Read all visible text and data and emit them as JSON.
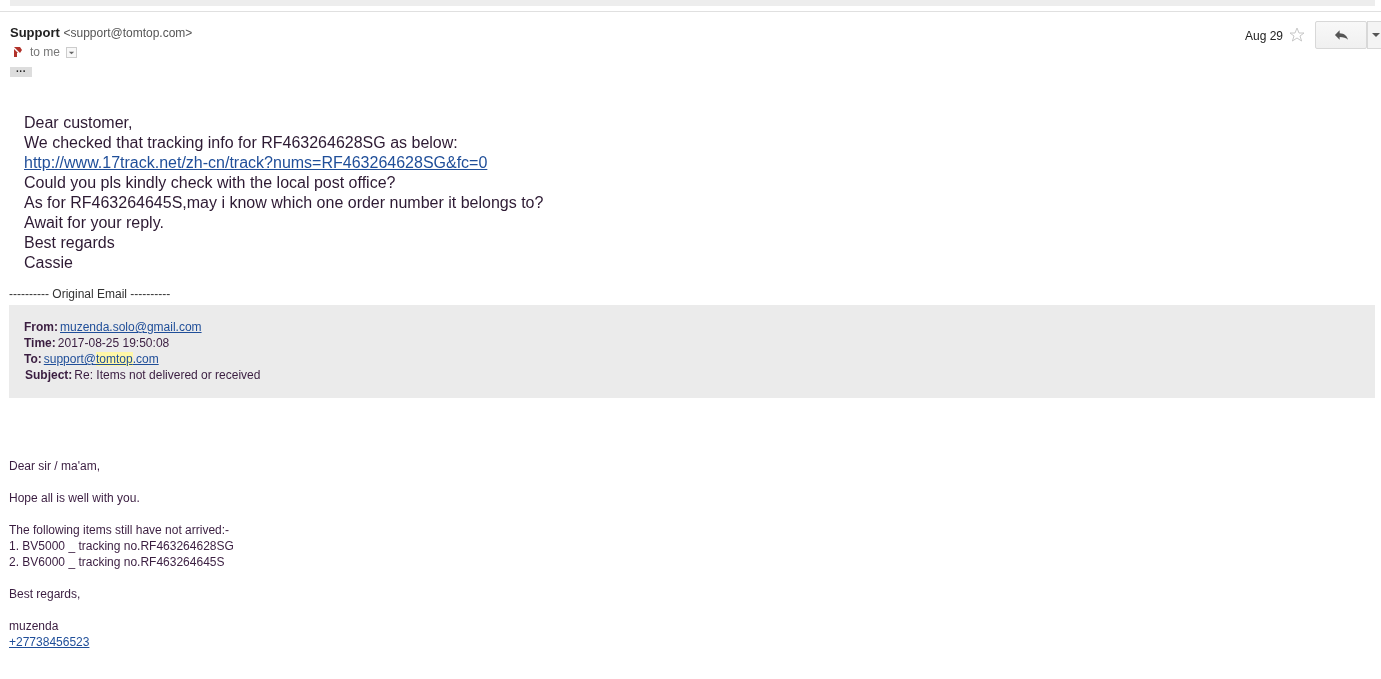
{
  "header": {
    "sender_name": "Support",
    "sender_email": "<support@tomtop.com>",
    "recipient": "to me",
    "date": "Aug 29",
    "starred": false,
    "more_label": "···"
  },
  "reply": [
    {
      "kind": "text",
      "text": "Dear customer,"
    },
    {
      "kind": "text",
      "text": "We checked that tracking info for RF463264628SG as below:"
    },
    {
      "kind": "link",
      "text": "http://www.17track.net/zh-cn/track?nums=RF463264628SG&fc=0"
    },
    {
      "kind": "text",
      "text": "Could you pls kindly check with the local post office?"
    },
    {
      "kind": "text",
      "text": "As for RF463264645S,may i know which one order number it belongs to?"
    },
    {
      "kind": "text",
      "text": "Await for your reply."
    },
    {
      "kind": "text",
      "text": "Best regards"
    },
    {
      "kind": "text",
      "text": "Cassie"
    }
  ],
  "divider": "---------- Original Email ----------",
  "original": {
    "from_label": "From:",
    "from": "muzenda.solo@gmail.com",
    "time_label": "Time:",
    "time": "2017-08-25 19:50:08",
    "to_label": "To:",
    "to": {
      "before": "support@",
      "highlight": "tomtop",
      "after": ".com"
    },
    "subject_label": "Subject:",
    "subject": "Re: Items not delivered or received"
  },
  "message": [
    {
      "lines": [
        {
          "kind": "text",
          "text": "Dear sir / ma'am,"
        }
      ]
    },
    {
      "lines": [
        {
          "kind": "text",
          "text": "Hope all is well with you."
        }
      ]
    },
    {
      "lines": [
        {
          "kind": "text",
          "text": "The following items still have not arrived:-"
        },
        {
          "kind": "text",
          "text": "1. BV5000 _ tracking no.RF463264628SG"
        },
        {
          "kind": "text",
          "text": "2. BV6000 _ tracking no.RF463264645S"
        }
      ]
    },
    {
      "lines": [
        {
          "kind": "text",
          "text": "Best regards,"
        }
      ]
    },
    {
      "lines": [
        {
          "kind": "text",
          "text": "muzenda"
        },
        {
          "kind": "link",
          "text": "+27738456523"
        }
      ]
    }
  ]
}
